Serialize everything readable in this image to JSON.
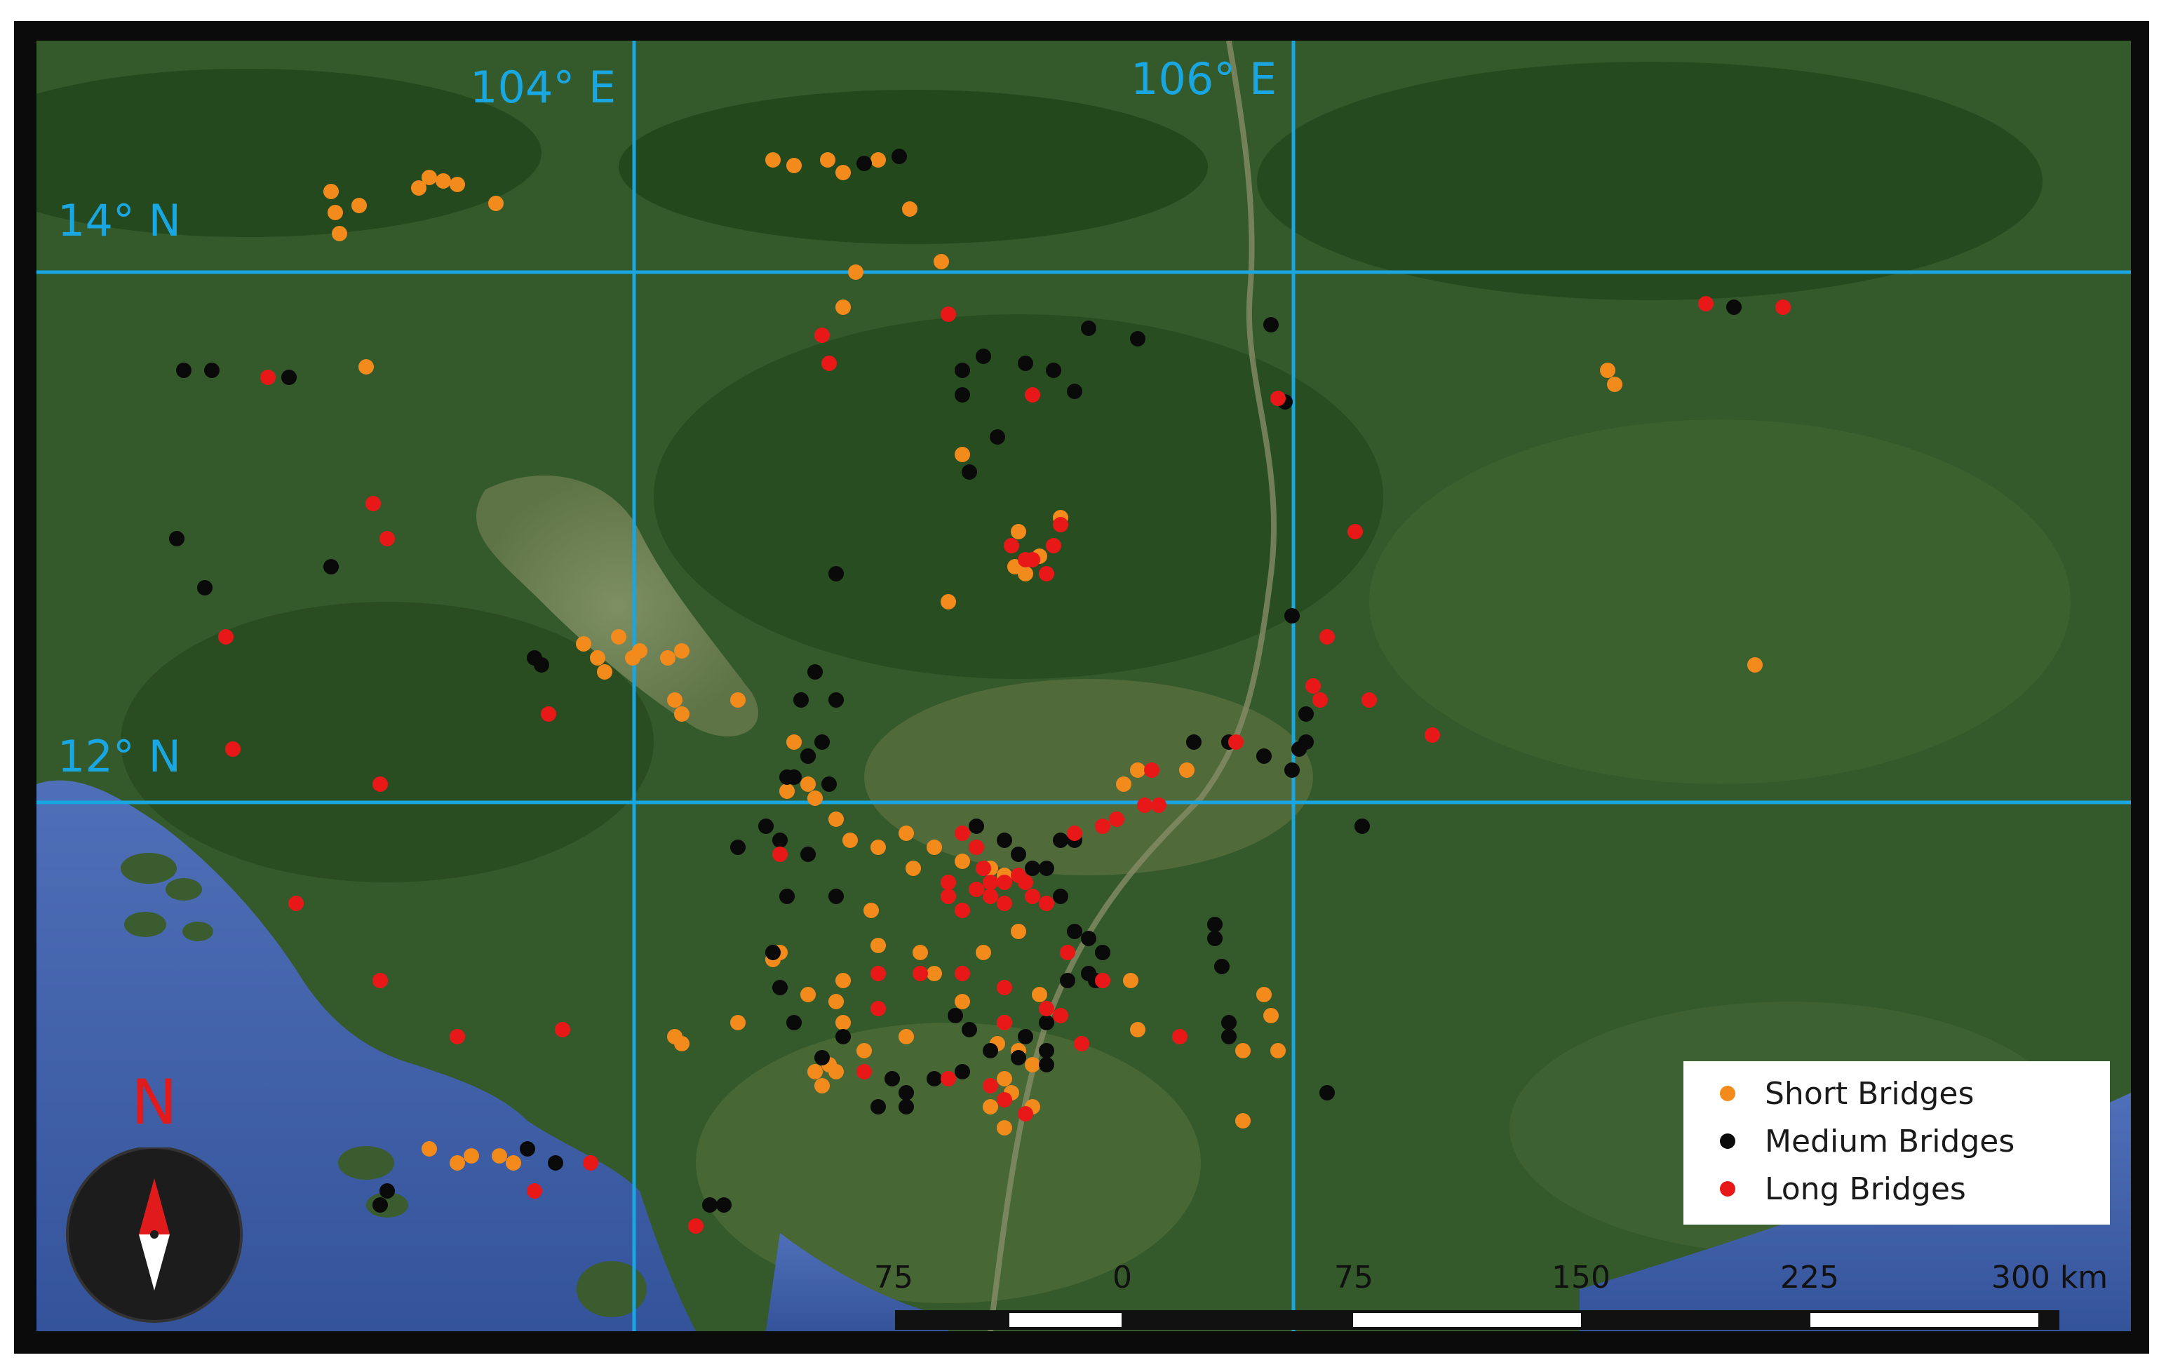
{
  "map": {
    "grid_labels": {
      "lon_104": "104° E",
      "lon_106": "106° E",
      "lat_14": "14° N",
      "lat_12": "12° N"
    },
    "legend": {
      "items": [
        {
          "label": "Short Bridges",
          "color": "#f28a1c"
        },
        {
          "label": "Medium Bridges",
          "color": "#0a0a0a"
        },
        {
          "label": "Long Bridges",
          "color": "#e81818"
        }
      ]
    },
    "north_arrow": {
      "label": "N",
      "icon": "compass-north-arrow-icon"
    },
    "scale_bar": {
      "labels": [
        "75",
        "0",
        "75",
        "150",
        "225",
        "300 km"
      ]
    },
    "colors": {
      "grid": "#1aa6e0",
      "sea": "#3d5fa8",
      "vegetation": "#2f5226",
      "short": "#f28a1c",
      "medium": "#0a0a0a",
      "long": "#e81818"
    }
  }
}
